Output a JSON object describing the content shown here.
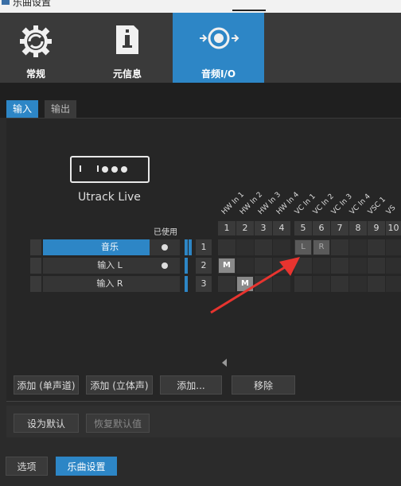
{
  "window": {
    "title": "乐曲设置"
  },
  "top_tabs": [
    {
      "label": "常规",
      "icon": "gear-icon"
    },
    {
      "label": "元信息",
      "icon": "document-icon"
    },
    {
      "label": "音频I/O",
      "icon": "speaker-io-icon"
    }
  ],
  "sub_tabs": [
    {
      "label": "输入"
    },
    {
      "label": "输出"
    }
  ],
  "device": {
    "name": "Utrack Live"
  },
  "used_header": "已使用",
  "rows": [
    {
      "name": "音乐",
      "used": true,
      "index": "1"
    },
    {
      "name": "输入 L",
      "used": true,
      "index": "2"
    },
    {
      "name": "输入 R",
      "used": false,
      "index": "3"
    }
  ],
  "columns": [
    {
      "label": "HW In 1",
      "num": "1"
    },
    {
      "label": "HW In 2",
      "num": "2"
    },
    {
      "label": "HW In 3",
      "num": "3"
    },
    {
      "label": "HW In 4",
      "num": "4"
    },
    {
      "label": "VC In 1",
      "num": "5"
    },
    {
      "label": "VC In 2",
      "num": "6"
    },
    {
      "label": "VC In 3",
      "num": "7"
    },
    {
      "label": "VC In 4",
      "num": "8"
    },
    {
      "label": "VSC 1",
      "num": "9"
    },
    {
      "label": "VS",
      "num": "10"
    }
  ],
  "matrix_marks": {
    "r1_c5": "L",
    "r1_c6": "R",
    "r2_c1": "M",
    "r3_c2": "M"
  },
  "buttons": {
    "add_mono": "添加 (单声道)",
    "add_stereo": "添加 (立体声)",
    "add": "添加...",
    "remove": "移除",
    "set_default": "设为默认",
    "restore_default": "恢复默认值",
    "options": "选项",
    "song_settings": "乐曲设置"
  },
  "colors": {
    "accent": "#2d86c6",
    "arrow": "#e8342f",
    "background": "#2b2b2b"
  }
}
